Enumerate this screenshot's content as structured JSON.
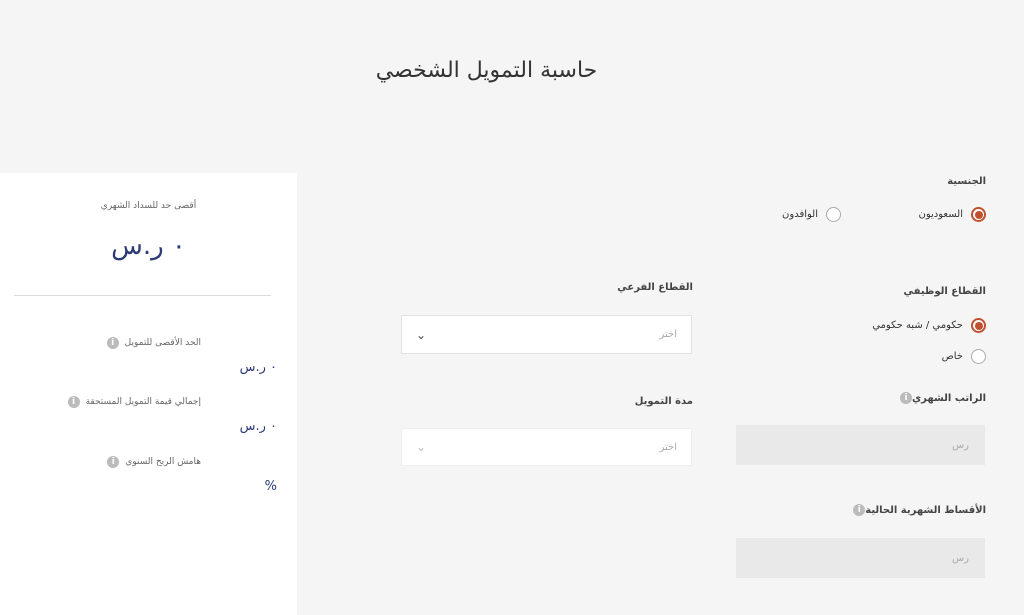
{
  "page": {
    "title": "حاسبة التمويل الشخصي"
  },
  "nationality": {
    "label": "الجنسية",
    "options": [
      {
        "label": "السعوديون",
        "checked": true
      },
      {
        "label": "الوافدون",
        "checked": false
      }
    ]
  },
  "sector": {
    "label": "القطاع الوظيفي",
    "options": [
      {
        "label": "حكومي / شبه حكومي",
        "checked": true
      },
      {
        "label": "خاص",
        "checked": false
      }
    ]
  },
  "sub_sector": {
    "label": "القطاع الفرعي",
    "placeholder": "اختر"
  },
  "salary": {
    "label": "الراتب الشهري",
    "placeholder": "رس"
  },
  "finance_period": {
    "label": "مدة التمويل",
    "placeholder": "اختر"
  },
  "installments": {
    "label": "الأقساط الشهرية الحالية",
    "placeholder": "رس"
  },
  "results": {
    "max_payment_label": "أقصى حد للسداد الشهري",
    "max_payment_value": "٠ ر.س",
    "max_finance_label": "الحد الأقصى للتمويل",
    "max_finance_value": "٠ ر.س",
    "total_due_label": "إجمالي قيمة التمويل المستحقة",
    "total_due_value": "٠ ر.س",
    "annual_margin_label": "هامش الربح السنوي",
    "annual_margin_value": "%"
  },
  "icons": {
    "info": "info-icon",
    "chevron": "chevron-down-icon"
  },
  "colors": {
    "accent": "#c1502e",
    "value": "#2c3c78"
  }
}
